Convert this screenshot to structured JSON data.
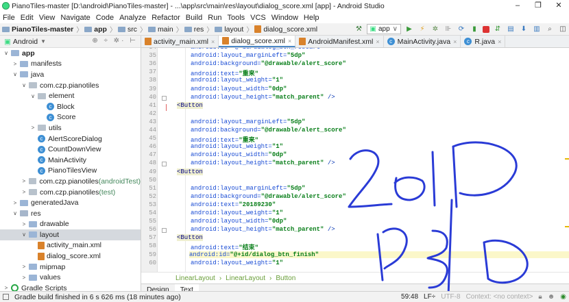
{
  "window": {
    "title": "PianoTiles-master [D:\\android\\PianoTiles-master] - ...\\app\\src\\main\\res\\layout\\dialog_score.xml [app] - Android Studio",
    "controls": [
      "–",
      "❐",
      "✕"
    ]
  },
  "menu": [
    "File",
    "Edit",
    "View",
    "Navigate",
    "Code",
    "Analyze",
    "Refactor",
    "Build",
    "Run",
    "Tools",
    "VCS",
    "Window",
    "Help"
  ],
  "breadcrumb": [
    "PianoTiles-master",
    "app",
    "src",
    "main",
    "res",
    "layout",
    "dialog_score.xml"
  ],
  "run_config": "app",
  "project_panel": {
    "view_label": "Android",
    "icons": "⊕ ÷ ✲· ⊢"
  },
  "tree": [
    {
      "label": "app",
      "level": 0,
      "arrow": "∨",
      "icon": "folder",
      "bold": true
    },
    {
      "label": "manifests",
      "level": 1,
      "arrow": ">",
      "icon": "folder"
    },
    {
      "label": "java",
      "level": 1,
      "arrow": "∨",
      "icon": "folder"
    },
    {
      "label": "com.czp.pianotiles",
      "level": 2,
      "arrow": "∨",
      "icon": "pkg"
    },
    {
      "label": "element",
      "level": 3,
      "arrow": "∨",
      "icon": "pkg"
    },
    {
      "label": "Block",
      "level": 4,
      "arrow": "",
      "icon": "class"
    },
    {
      "label": "Score",
      "level": 4,
      "arrow": "",
      "icon": "class"
    },
    {
      "label": "utils",
      "level": 3,
      "arrow": ">",
      "icon": "pkg"
    },
    {
      "label": "AlertScoreDialog",
      "level": 3,
      "arrow": "",
      "icon": "class"
    },
    {
      "label": "CountDownView",
      "level": 3,
      "arrow": "",
      "icon": "class"
    },
    {
      "label": "MainActivity",
      "level": 3,
      "arrow": "",
      "icon": "class"
    },
    {
      "label": "PianoTilesView",
      "level": 3,
      "arrow": "",
      "icon": "class"
    },
    {
      "label": "com.czp.pianotiles",
      "suffix": " (androidTest)",
      "level": 2,
      "arrow": ">",
      "icon": "pkg"
    },
    {
      "label": "com.czp.pianotiles",
      "suffix": " (test)",
      "level": 2,
      "arrow": ">",
      "icon": "pkg"
    },
    {
      "label": "generatedJava",
      "level": 1,
      "arrow": ">",
      "icon": "folder"
    },
    {
      "label": "res",
      "level": 1,
      "arrow": "∨",
      "icon": "res"
    },
    {
      "label": "drawable",
      "level": 2,
      "arrow": ">",
      "icon": "folder"
    },
    {
      "label": "layout",
      "level": 2,
      "arrow": "∨",
      "icon": "folder",
      "selected": true
    },
    {
      "label": "activity_main.xml",
      "level": 3,
      "arrow": "",
      "icon": "xml"
    },
    {
      "label": "dialog_score.xml",
      "level": 3,
      "arrow": "",
      "icon": "xml"
    },
    {
      "label": "mipmap",
      "level": 2,
      "arrow": ">",
      "icon": "folder"
    },
    {
      "label": "values",
      "level": 2,
      "arrow": ">",
      "icon": "folder"
    },
    {
      "label": "Gradle Scripts",
      "level": 0,
      "arrow": ">",
      "icon": "gradle"
    }
  ],
  "tabs": [
    {
      "label": "activity_main.xml",
      "icon": "xml"
    },
    {
      "label": "dialog_score.xml",
      "icon": "xml",
      "active": true
    },
    {
      "label": "AndroidManifest.xml",
      "icon": "xml"
    },
    {
      "label": "MainActivity.java",
      "icon": "class"
    },
    {
      "label": "R.java",
      "icon": "class"
    }
  ],
  "code": [
    {
      "n": "34",
      "t": "android:id=\"@+id/dialog_btn_restart\"",
      "k": "line"
    },
    {
      "n": "35",
      "a": "android:layout_marginLeft=",
      "v": "\"5dp\""
    },
    {
      "n": "36",
      "a": "android:background=",
      "v": "\"@drawable/alert_score\""
    },
    {
      "n": "37",
      "a": "android:text=",
      "v": "\"重来\""
    },
    {
      "n": "38",
      "a": "android:layout_weight=",
      "v": "\"1\""
    },
    {
      "n": "39",
      "a": "android:layout_width=",
      "v": "\"0dp\""
    },
    {
      "n": "40",
      "a": "android:layout_height=",
      "v": "\"match_parent\"",
      "e": " />"
    },
    {
      "n": "41",
      "tag": "<Button"
    },
    {
      "n": "42",
      "a": "",
      "v": ""
    },
    {
      "n": "43",
      "a": "android:layout_marginLeft=",
      "v": "\"5dp\""
    },
    {
      "n": "44",
      "a": "android:background=",
      "v": "\"@drawable/alert_score\""
    },
    {
      "n": "45",
      "a": "android:text=",
      "v": "\"重来\""
    },
    {
      "n": "46",
      "a": "android:layout_weight=",
      "v": "\"1\""
    },
    {
      "n": "47",
      "a": "android:layout_width=",
      "v": "\"0dp\""
    },
    {
      "n": "48",
      "a": "android:layout_height=",
      "v": "\"match_parent\"",
      "e": " />"
    },
    {
      "n": "49",
      "tag": "<Button"
    },
    {
      "n": "50",
      "a": "",
      "v": ""
    },
    {
      "n": "51",
      "a": "android:layout_marginLeft=",
      "v": "\"5dp\""
    },
    {
      "n": "52",
      "a": "android:background=",
      "v": "\"@drawable/alert_score\""
    },
    {
      "n": "53",
      "a": "android:text=",
      "v": "\"20189230\""
    },
    {
      "n": "54",
      "a": "android:layout_weight=",
      "v": "\"1\""
    },
    {
      "n": "55",
      "a": "android:layout_width=",
      "v": "\"0dp\""
    },
    {
      "n": "56",
      "a": "android:layout_height=",
      "v": "\"match_parent\"",
      "e": " />"
    },
    {
      "n": "57",
      "tag": "<Button"
    },
    {
      "n": "58",
      "a": "android:text=",
      "v": "\"结束\""
    },
    {
      "n": "59",
      "a": "android:id=",
      "v": "\"@+id/dialog_btn_finish\"",
      "hl": true
    },
    {
      "n": "60",
      "a": "android:layout_weight=",
      "v": "\"1\""
    }
  ],
  "editor_breadcrumb": [
    "LinearLayout",
    "LinearLayout",
    "Button"
  ],
  "mode_tabs": [
    "Design",
    "Text"
  ],
  "status": {
    "message": "Gradle build finished in 6 s 626 ms (18 minutes ago)",
    "position": "59:48",
    "line_sep": "LF÷",
    "encoding": "UTF-8",
    "context": "Context: <no context>"
  },
  "ink_color": "#2a3bd6"
}
